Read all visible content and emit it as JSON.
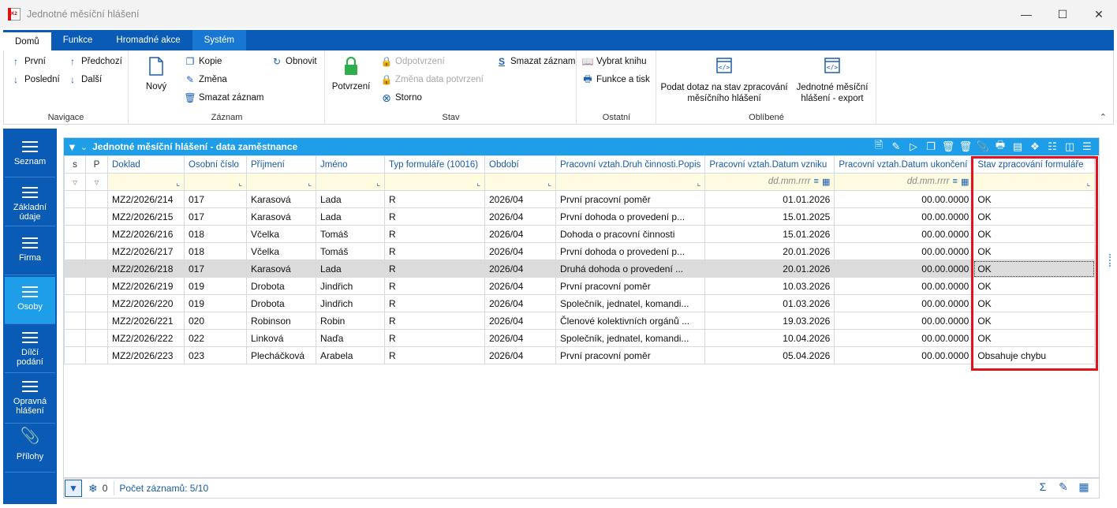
{
  "window": {
    "title": "Jednotné měsíční hlášení",
    "app_icon_text": "K2"
  },
  "tabs": [
    "Domů",
    "Funkce",
    "Hromadné akce",
    "Systém"
  ],
  "ribbon": {
    "navigace": {
      "label": "Navigace",
      "first": "První",
      "prev": "Předchozí",
      "last": "Poslední",
      "next": "Další"
    },
    "zaznam": {
      "label": "Záznam",
      "new": "Nový",
      "copy": "Kopie",
      "change": "Změna",
      "delete": "Smazat záznam",
      "refresh": "Obnovit"
    },
    "stav": {
      "label": "Stav",
      "confirm": "Potvrzení",
      "unconfirm": "Odpotvrzení",
      "change_date": "Změna data potvrzení",
      "storno": "Storno",
      "delete": "Smazat záznam"
    },
    "ostatni": {
      "label": "Ostatní",
      "book": "Vybrat knihu",
      "print": "Funkce a tisk"
    },
    "oblibene": {
      "label": "Oblíbené",
      "query": "Podat dotaz na stav zpracování měsíčního hlášení",
      "export": "Jednotné měsíční hlášení - export"
    }
  },
  "leftnav": [
    {
      "label": "Seznam"
    },
    {
      "label": "Základní údaje"
    },
    {
      "label": "Firma"
    },
    {
      "label": "Osoby"
    },
    {
      "label": "Dílčí podání"
    },
    {
      "label": "Opravná hlášení"
    },
    {
      "label": "Přílohy"
    }
  ],
  "grid": {
    "title": "Jednotné měsíční hlášení - data zaměstnance",
    "columns": [
      "s",
      "P",
      "Doklad",
      "Osobní číslo",
      "Příjmení",
      "Jméno",
      "Typ formuláře (10016)",
      "Období",
      "Pracovní vztah.Druh činnosti.Popis",
      "Pracovní vztah.Datum vzniku",
      "Pracovní vztah.Datum ukončení",
      "Stav zpracování formuláře"
    ],
    "date_placeholder": "dd.mm.rrrr",
    "rows": [
      [
        "",
        "",
        "MZ2/2026/214",
        "017",
        "Karasová",
        "Lada",
        "R",
        "2026/04",
        "První pracovní poměr",
        "01.01.2026",
        "00.00.0000",
        "OK"
      ],
      [
        "",
        "",
        "MZ2/2026/215",
        "017",
        "Karasová",
        "Lada",
        "R",
        "2026/04",
        "První dohoda o provedení p...",
        "15.01.2025",
        "00.00.0000",
        "OK"
      ],
      [
        "",
        "",
        "MZ2/2026/216",
        "018",
        "Včelka",
        "Tomáš",
        "R",
        "2026/04",
        "Dohoda o pracovní činnosti",
        "15.01.2026",
        "00.00.0000",
        "OK"
      ],
      [
        "",
        "",
        "MZ2/2026/217",
        "018",
        "Včelka",
        "Tomáš",
        "R",
        "2026/04",
        "První dohoda o provedení p...",
        "20.01.2026",
        "00.00.0000",
        "OK"
      ],
      [
        "",
        "",
        "MZ2/2026/218",
        "017",
        "Karasová",
        "Lada",
        "R",
        "2026/04",
        "Druhá dohoda o provedení ...",
        "20.01.2026",
        "00.00.0000",
        "OK"
      ],
      [
        "",
        "",
        "MZ2/2026/219",
        "019",
        "Drobota",
        "Jindřich",
        "R",
        "2026/04",
        "První pracovní poměr",
        "10.03.2026",
        "00.00.0000",
        "OK"
      ],
      [
        "",
        "",
        "MZ2/2026/220",
        "019",
        "Drobota",
        "Jindřich",
        "R",
        "2026/04",
        "Společník, jednatel, komandi...",
        "01.03.2026",
        "00.00.0000",
        "OK"
      ],
      [
        "",
        "",
        "MZ2/2026/221",
        "020",
        "Robinson",
        "Robin",
        "R",
        "2026/04",
        "Členové kolektivních orgánů ...",
        "19.03.2026",
        "00.00.0000",
        "OK"
      ],
      [
        "",
        "",
        "MZ2/2026/222",
        "022",
        "Linková",
        "Naďa",
        "R",
        "2026/04",
        "Společník, jednatel, komandi...",
        "10.04.2026",
        "00.00.0000",
        "OK"
      ],
      [
        "",
        "",
        "MZ2/2026/223",
        "023",
        "Plecháčková",
        "Arabela",
        "R",
        "2026/04",
        "První pracovní poměr",
        "05.04.2026",
        "00.00.0000",
        "Obsahuje chybu"
      ]
    ],
    "selected_row": 4
  },
  "status": {
    "filter_count": "0",
    "records": "Počet záznamů: 5/10"
  },
  "colors": {
    "ribbon_blue": "#0a5bb5",
    "panel_blue": "#1e9de8",
    "highlight_red": "#e0141e",
    "filter_yellow": "#fffbe0"
  }
}
